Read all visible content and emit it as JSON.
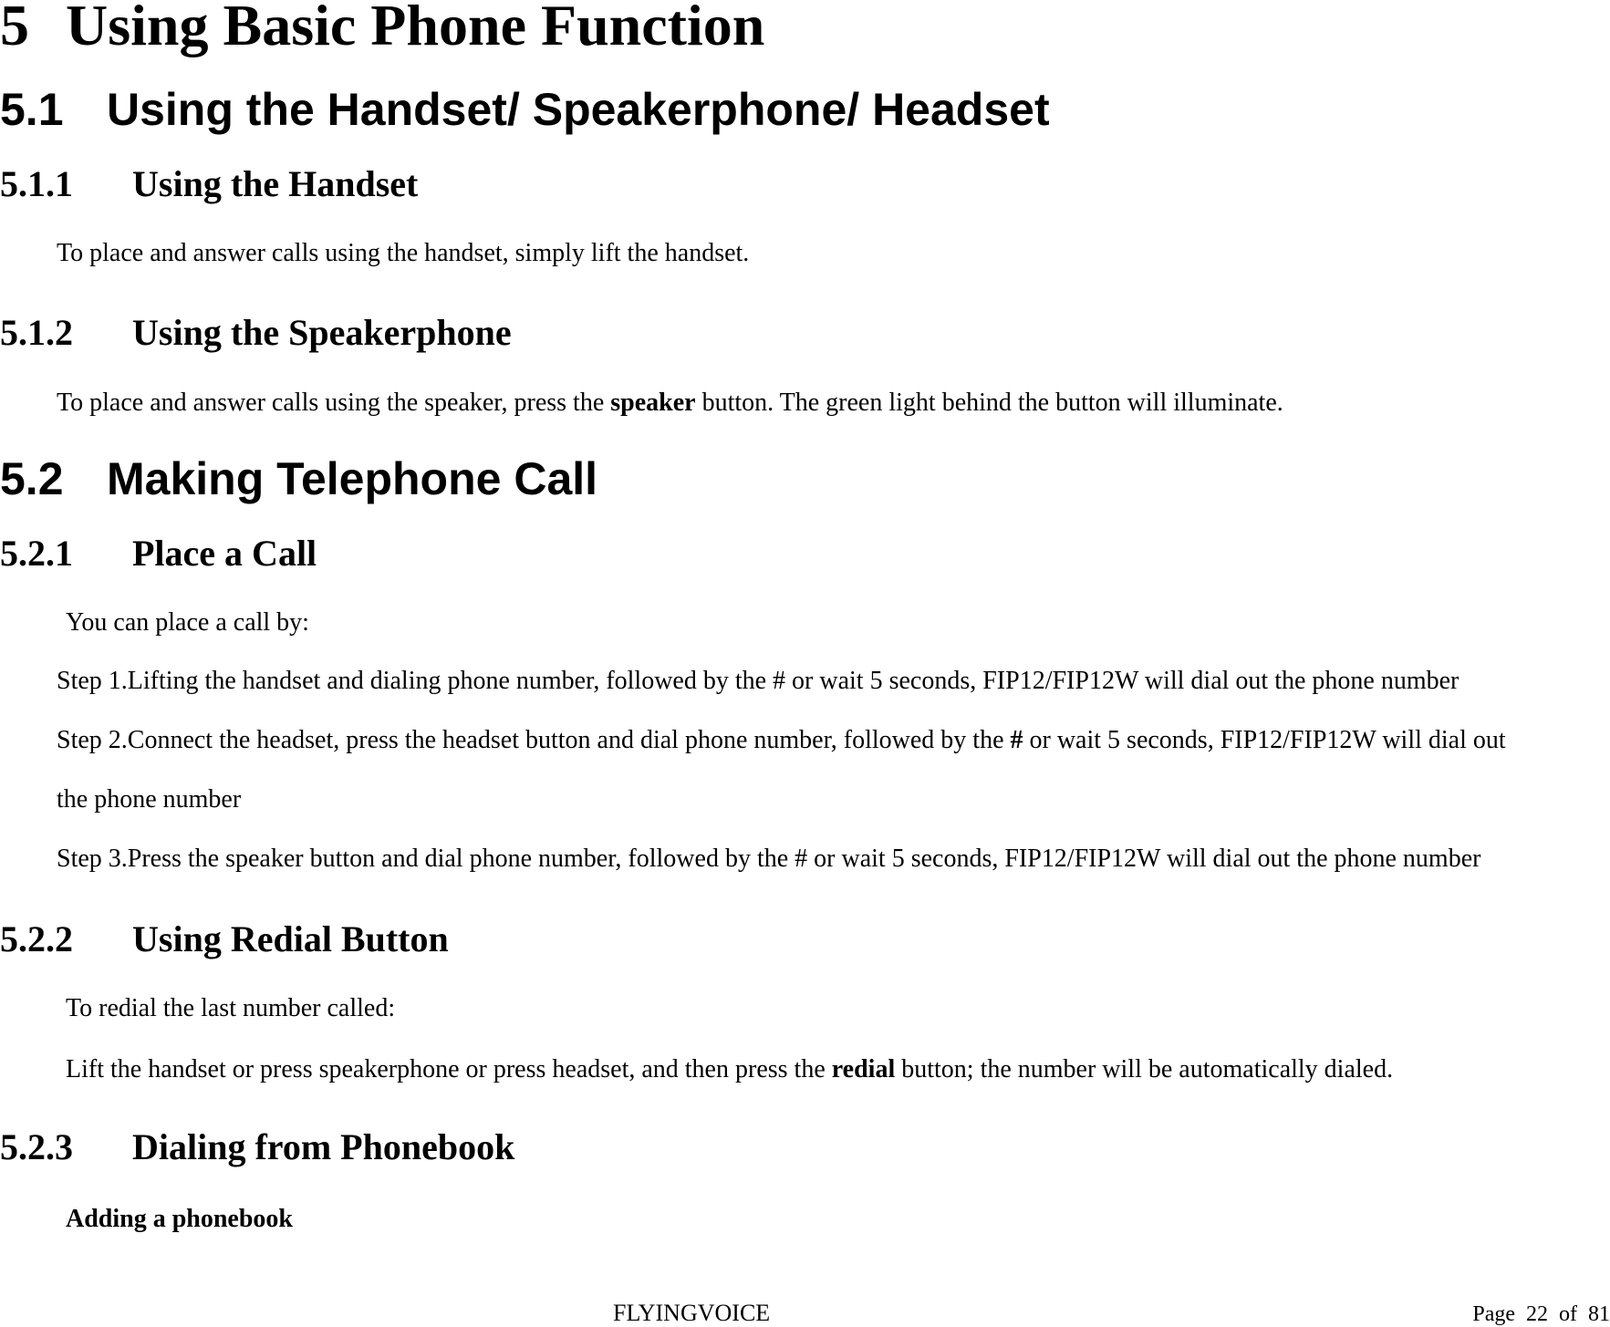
{
  "chapter": {
    "number": "5",
    "title": "Using Basic Phone Function"
  },
  "sections": {
    "s5_1": {
      "number": "5.1",
      "title": "Using the Handset/ Speakerphone/ Headset",
      "s5_1_1": {
        "number": "5.1.1",
        "title": "Using the Handset",
        "body": "To place and answer calls using the handset, simply lift the handset."
      },
      "s5_1_2": {
        "number": "5.1.2",
        "title": "Using the Speakerphone",
        "body_before": "To place and answer calls using the speaker, press the ",
        "body_bold": "speaker",
        "body_after": " button. The green light behind the button will illuminate."
      }
    },
    "s5_2": {
      "number": "5.2",
      "title": "Making Telephone Call",
      "s5_2_1": {
        "number": "5.2.1",
        "title": "Place a Call",
        "intro": "You can place a call by:",
        "steps": [
          {
            "text": "Step 1.Lifting the handset and dialing phone number, followed by the # or wait 5 seconds, FIP12/FIP12W will dial out the phone number"
          },
          {
            "before": "Step 2.Connect the headset, press the headset button and dial phone number, followed by the ",
            "bold": "#",
            "after": " or wait 5 seconds, FIP12/FIP12W will dial out",
            "continuation": "the phone number"
          },
          {
            "text": "Step 3.Press the speaker button and dial phone number, followed by the # or wait 5 seconds, FIP12/FIP12W will dial out the phone number"
          }
        ]
      },
      "s5_2_2": {
        "number": "5.2.2",
        "title": "Using Redial Button",
        "intro": "To redial the last number called:",
        "body_before": "Lift the handset or press speakerphone or press headset, and then press the ",
        "body_bold": "redial",
        "body_after": " button; the number will be automatically dialed."
      },
      "s5_2_3": {
        "number": "5.2.3",
        "title": "Dialing from Phonebook",
        "subheading": "Adding a phonebook"
      }
    }
  },
  "footer": {
    "brand": "FLYINGVOICE",
    "page_label": "Page",
    "page_current": "22",
    "page_of": "of",
    "page_total": "81"
  }
}
